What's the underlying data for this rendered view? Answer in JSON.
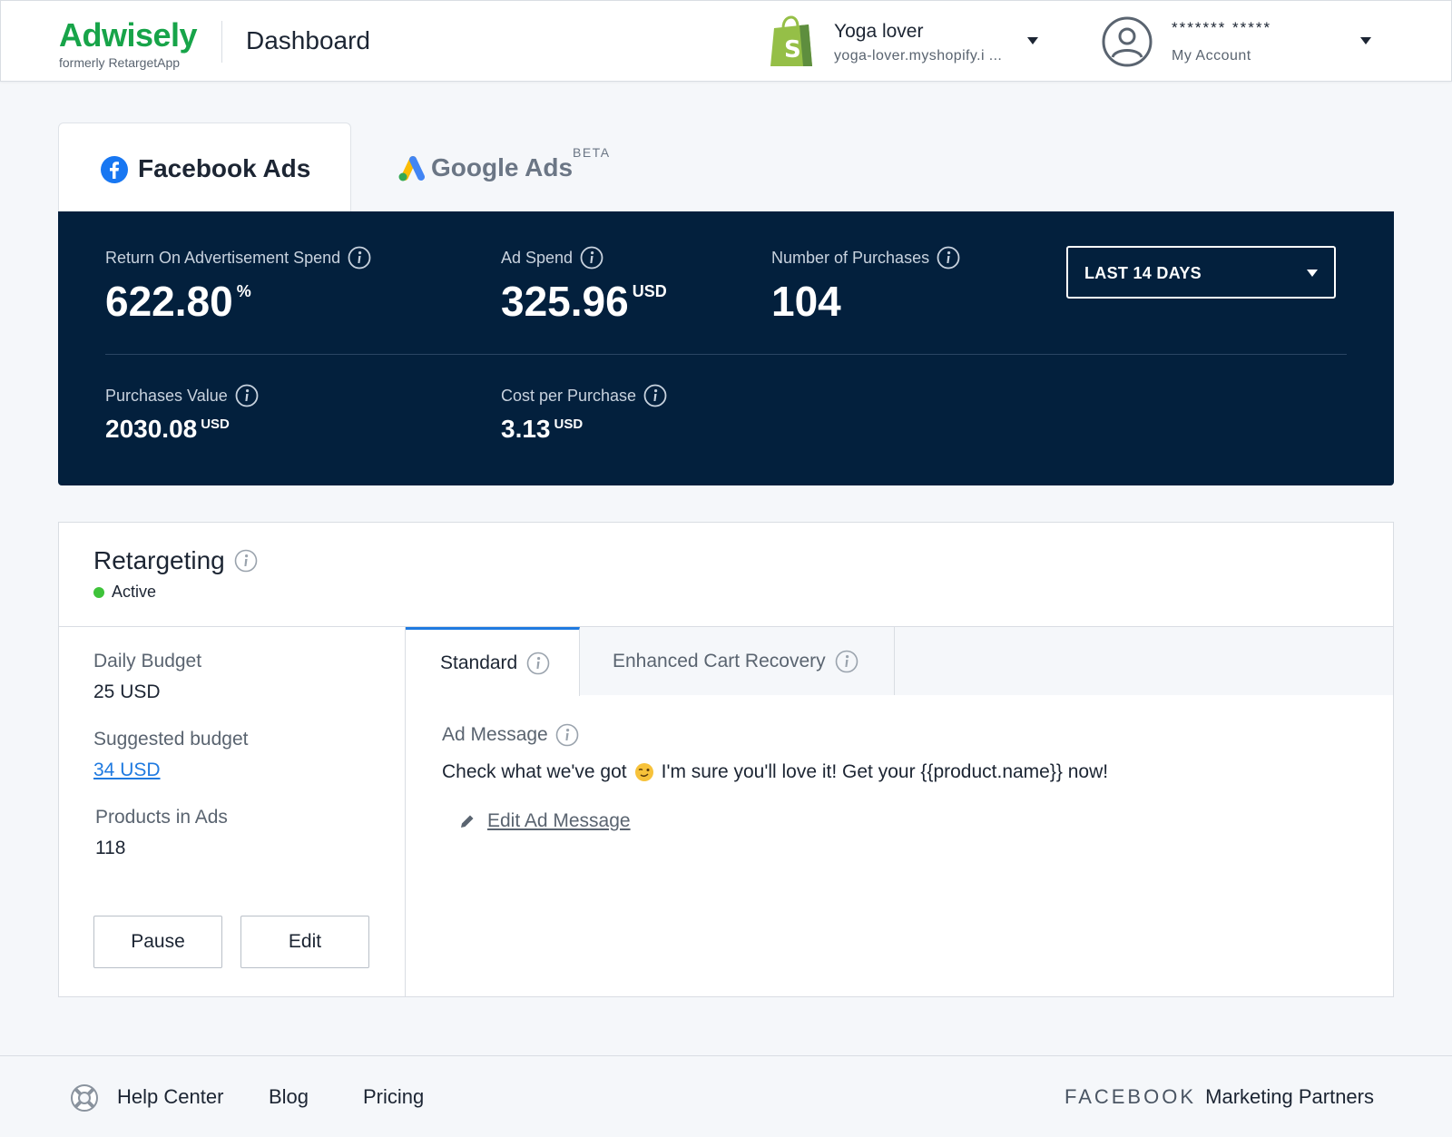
{
  "header": {
    "brand_name": "Adwisely",
    "brand_sub": "formerly RetargetApp",
    "page_title": "Dashboard",
    "store_name": "Yoga lover",
    "store_url": "yoga-lover.myshopify.i ...",
    "account_name": "******* *****",
    "account_sub": "My Account"
  },
  "tabs": {
    "facebook": "Facebook Ads",
    "google": "Google Ads",
    "google_badge": "BETA"
  },
  "metrics": {
    "roas_label": "Return On Advertisement Spend",
    "roas_value": "622.80",
    "roas_unit": "%",
    "spend_label": "Ad Spend",
    "spend_value": "325.96",
    "spend_unit": "USD",
    "purchases_label": "Number of Purchases",
    "purchases_value": "104",
    "purchases_value_label": "Purchases Value",
    "purchases_value_value": "2030.08",
    "purchases_value_unit": "USD",
    "cpp_label": "Cost per Purchase",
    "cpp_value": "3.13",
    "cpp_unit": "USD",
    "date_range": "LAST 14 DAYS"
  },
  "retargeting": {
    "title": "Retargeting",
    "status": "Active",
    "daily_budget_label": "Daily Budget",
    "daily_budget_value": "25 USD",
    "suggested_label": "Suggested budget",
    "suggested_value": "34 USD",
    "products_label": "Products in Ads",
    "products_value": "118",
    "pause_label": "Pause",
    "edit_label": "Edit",
    "subtab_standard": "Standard",
    "subtab_ecr": "Enhanced Cart Recovery",
    "ad_message_label": "Ad Message",
    "ad_message_part1": "Check what we've got",
    "ad_message_part2": "I'm sure you'll love it! Get your {{product.name}} now!",
    "edit_message_label": "Edit Ad Message"
  },
  "footer": {
    "help": "Help Center",
    "blog": "Blog",
    "pricing": "Pricing",
    "partner_brand": "FACEBOOK",
    "partner_text": "Marketing Partners"
  },
  "colors": {
    "brand_green": "#17a449",
    "panel_navy": "#03203d",
    "link_blue": "#1f7ae0",
    "active_green": "#3ec33a"
  }
}
